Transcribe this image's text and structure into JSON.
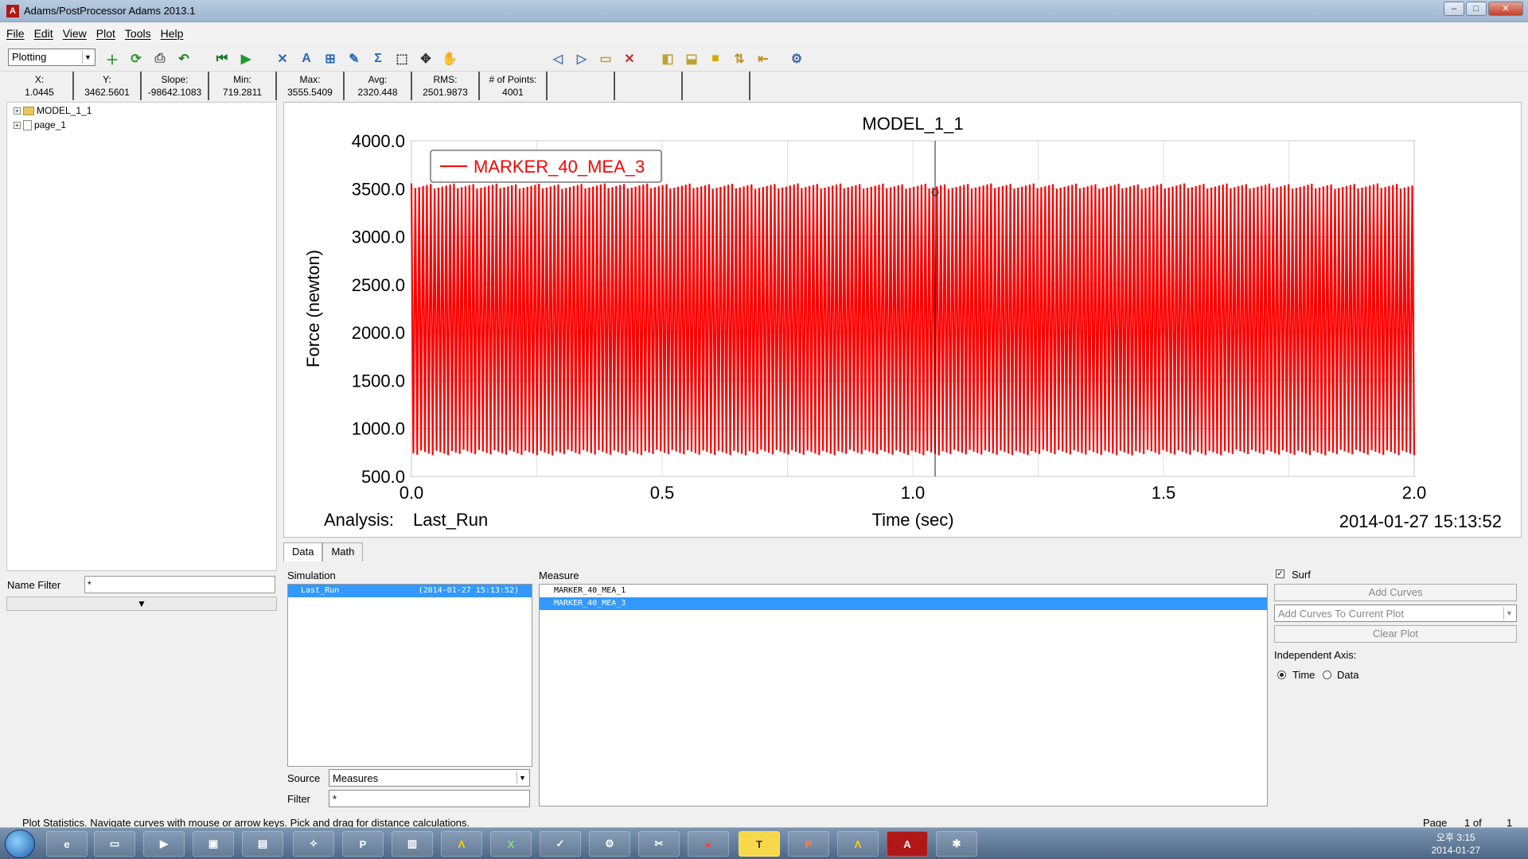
{
  "window": {
    "title": "Adams/PostProcessor Adams 2013.1",
    "icon_letter": "A"
  },
  "menu": [
    "File",
    "Edit",
    "View",
    "Plot",
    "Tools",
    "Help"
  ],
  "toolbar": {
    "mode": "Plotting"
  },
  "stats": [
    {
      "label": "X:",
      "value": "1.0445"
    },
    {
      "label": "Y:",
      "value": "3462.5601"
    },
    {
      "label": "Slope:",
      "value": "-98642.1083"
    },
    {
      "label": "Min:",
      "value": "719.2811"
    },
    {
      "label": "Max:",
      "value": "3555.5409"
    },
    {
      "label": "Avg:",
      "value": "2320.448"
    },
    {
      "label": "RMS:",
      "value": "2501.9873"
    },
    {
      "label": "# of Points:",
      "value": "4001"
    }
  ],
  "tree": {
    "items": [
      "MODEL_1_1",
      "page_1"
    ]
  },
  "name_filter": {
    "label": "Name Filter",
    "value": "*"
  },
  "chart_data": {
    "type": "line",
    "title": "MODEL_1_1",
    "xlabel": "Time (sec)",
    "ylabel": "Force (newton)",
    "xlim": [
      0.0,
      2.0
    ],
    "ylim": [
      500.0,
      4000.0
    ],
    "x_ticks": [
      "0.0",
      "0.5",
      "1.0",
      "1.5",
      "2.0"
    ],
    "y_ticks": [
      "500.0",
      "1000.0",
      "1500.0",
      "2000.0",
      "2500.0",
      "3000.0",
      "3500.0",
      "4000.0"
    ],
    "grid": true,
    "legend_position": "top-left",
    "series": [
      {
        "name": "MARKER_40_MEA_3",
        "color": "#ff0000",
        "min": 719.2811,
        "max": 3555.5409,
        "points": 4001
      }
    ],
    "cursor": {
      "x": 1.0445,
      "y": 3462.5601
    },
    "analysis_label": "Analysis:",
    "analysis_name": "Last_Run",
    "timestamp": "2014-01-27 15:13:52"
  },
  "tabs": [
    "Data",
    "Math"
  ],
  "simulation": {
    "label": "Simulation",
    "rows": [
      {
        "name": "Last_Run",
        "time": "(2014-01-27 15:13:52)"
      }
    ]
  },
  "measure": {
    "label": "Measure",
    "rows": [
      "MARKER_40_MEA_1",
      "MARKER_40_MEA_3"
    ]
  },
  "source": {
    "label": "Source",
    "value": "Measures"
  },
  "filter": {
    "label": "Filter",
    "value": "*"
  },
  "right_panel": {
    "surf_label": "Surf",
    "add_curves": "Add Curves",
    "add_mode": "Add Curves To Current Plot",
    "clear_plot": "Clear Plot",
    "indep_axis_label": "Independent Axis:",
    "time_label": "Time",
    "data_label": "Data"
  },
  "status": {
    "message": "Plot Statistics.  Navigate curves with mouse or arrow keys.  Pick and drag for distance calculations.",
    "page_label": "Page",
    "page_value": "1 of",
    "page_total": "1"
  },
  "taskbar": {
    "clock_time": "오후 3:15",
    "clock_date": "2014-01-27"
  }
}
